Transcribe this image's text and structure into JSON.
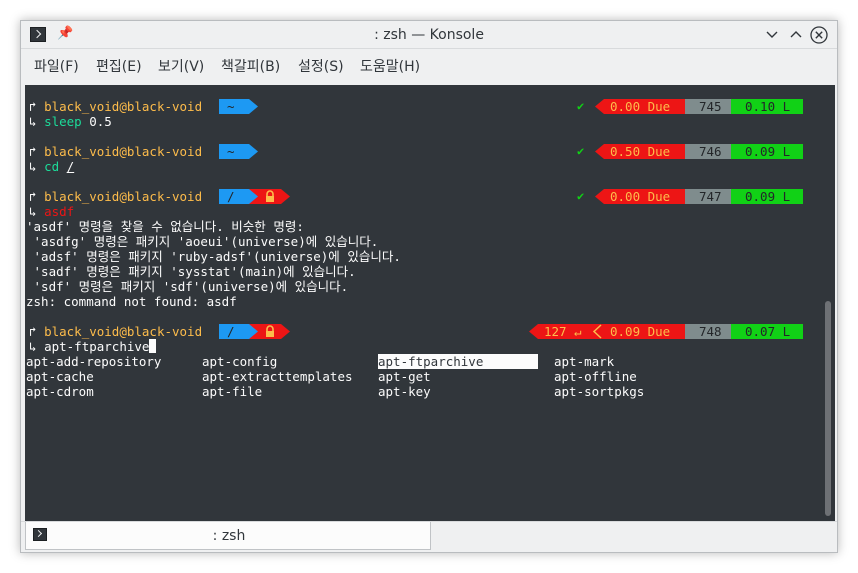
{
  "window": {
    "title": ": zsh — Konsole",
    "app_icon": "terminal-icon",
    "pin_icon": "pin-icon"
  },
  "menu": {
    "items": [
      "파일(F)",
      "편집(E)",
      "보기(V)",
      "책갈피(B)",
      "설정(S)",
      "도움말(H)"
    ]
  },
  "prompts": [
    {
      "arrow": "↱",
      "user": "black_void@black-void",
      "dir": "~",
      "locked": false,
      "status_icon": "check-icon",
      "status": "✔",
      "exit_code": "",
      "due": "0.00 Due",
      "history": "745",
      "load": "0.10 L"
    },
    {
      "arrow": "↱",
      "user": "black_void@black-void",
      "dir": "~",
      "locked": false,
      "status_icon": "check-icon",
      "status": "✔",
      "exit_code": "",
      "due": "0.50 Due",
      "history": "746",
      "load": "0.09 L"
    },
    {
      "arrow": "↱",
      "user": "black_void@black-void",
      "dir": "/",
      "locked": true,
      "status_icon": "check-icon",
      "status": "✔",
      "exit_code": "",
      "due": "0.00 Due",
      "history": "747",
      "load": "0.09 L"
    },
    {
      "arrow": "↱",
      "user": "black_void@black-void",
      "dir": "/",
      "locked": true,
      "status_icon": "return-icon",
      "status": "",
      "exit_code": "127 ↵",
      "due": "0.09 Due",
      "history": "748",
      "load": "0.07 L"
    }
  ],
  "commands": [
    {
      "arrow": "↳",
      "cmd": "sleep",
      "args": " 0.5"
    },
    {
      "arrow": "↳",
      "cmd": "cd",
      "args": "/"
    },
    {
      "arrow": "↳",
      "cmd": "asdf",
      "args": ""
    },
    {
      "arrow": "↳",
      "cmd": "apt-ftparchive",
      "args": ""
    }
  ],
  "error_output": [
    "'asdf' 명령을 찾을 수 없습니다. 비슷한 명령:",
    " 'asdfg' 명령은 패키지 'aoeui'(universe)에 있습니다.",
    " 'adsf' 명령은 패키지 'ruby-adsf'(universe)에 있습니다.",
    " 'sadf' 명령은 패키지 'sysstat'(main)에 있습니다.",
    " 'sdf' 명령은 패키지 'sdf'(universe)에 있습니다.",
    "zsh: command not found: asdf"
  ],
  "completions": {
    "selected": "apt-ftparchive",
    "items": [
      "apt-add-repository",
      "apt-config",
      "apt-ftparchive",
      "apt-mark",
      "apt-cache",
      "apt-extracttemplates",
      "apt-get",
      "apt-offline",
      "apt-cdrom",
      "apt-file",
      "apt-key",
      "apt-sortpkgs"
    ]
  },
  "tabs": [
    {
      "label": ": zsh",
      "icon": "terminal-icon",
      "active": true
    }
  ],
  "colors": {
    "terminal_bg": "#31363b",
    "user": "#fdbc4b",
    "command": "#1cdc9a",
    "error_command": "#ed1515",
    "dir_segment": "#1d99f3",
    "lock_segment": "#ed1515",
    "due_segment": "#ed1515",
    "history_segment": "#7f8c8d",
    "load_segment": "#11d116"
  }
}
